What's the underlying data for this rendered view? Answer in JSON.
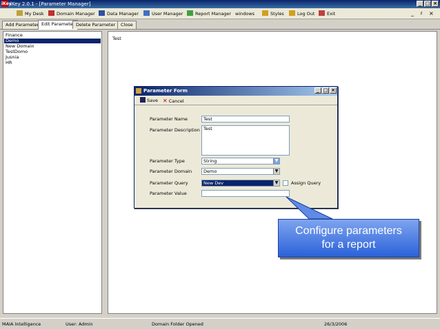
{
  "window": {
    "title": "iKey 2.0.1 - [Parameter Manager]",
    "logo_text": "iKey",
    "min": "_",
    "max": "□",
    "close": "×"
  },
  "menu": {
    "items": [
      {
        "label": "My Desk",
        "icon": "desk-icon",
        "color": "#c0a040"
      },
      {
        "label": "Domain Manager",
        "icon": "domain-icon",
        "color": "#c03030"
      },
      {
        "label": "Data Manager",
        "icon": "data-icon",
        "color": "#3050a0"
      },
      {
        "label": "User Manager",
        "icon": "user-icon",
        "color": "#4070c0"
      },
      {
        "label": "Report Manager",
        "icon": "report-icon",
        "color": "#40a040"
      },
      {
        "label": "windows"
      },
      {
        "label": "Styles",
        "icon": "styles-icon",
        "color": "#d0a020"
      },
      {
        "label": "Log Out",
        "icon": "logout-icon",
        "color": "#d0a020"
      },
      {
        "label": "Exit",
        "icon": "exit-icon",
        "color": "#c04040"
      }
    ],
    "mdi_min": "_",
    "mdi_restore": "♯",
    "mdi_close": "×"
  },
  "tabs": [
    "Add Parameter",
    "Edit Parameter",
    "Delete Parameter",
    "Close"
  ],
  "left_list": [
    "Finance",
    "Demo",
    "New Domain",
    "TestDomo",
    "Jusnia",
    "HR"
  ],
  "right_panel": {
    "text": "Test"
  },
  "dialog": {
    "title": "Parameter Form",
    "save": "Save",
    "cancel": "Cancel",
    "labels": {
      "name": "Parameter Name",
      "description": "Parameter Description",
      "type": "Parameter Type",
      "domain": "Parameter Domain",
      "query": "Parameter Query",
      "value": "Parameter Value"
    },
    "values": {
      "name": "Test",
      "description": "Test",
      "type": "String",
      "domain": "Demo",
      "query": "New Dev"
    },
    "assign_label": "Assign Query"
  },
  "callout": {
    "line1": "Configure parameters",
    "line2": "for a report"
  },
  "status": {
    "company": "MAIA Intelligence",
    "user": "User: Admin",
    "folder": "Domain Folder Opened",
    "date": "26/3/2006"
  }
}
